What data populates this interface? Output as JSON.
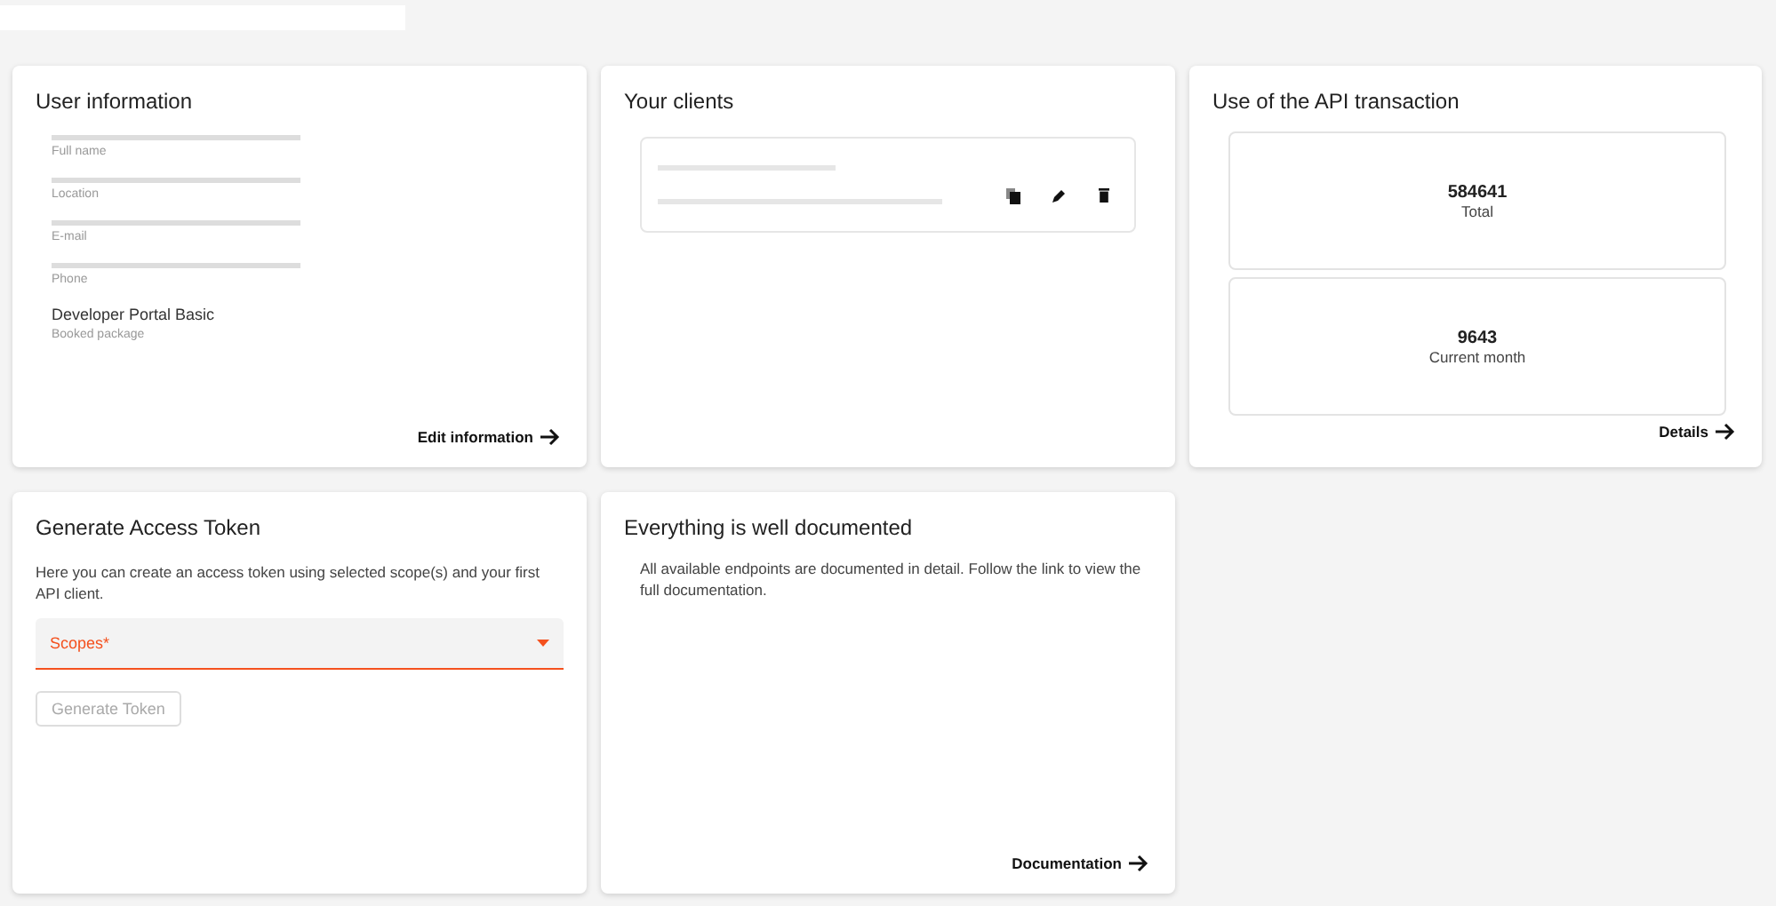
{
  "user_information": {
    "title": "User information",
    "fields": [
      {
        "label": "Full name",
        "redacted": true
      },
      {
        "label": "Location",
        "redacted": true
      },
      {
        "label": "E-mail",
        "redacted": true
      },
      {
        "label": "Phone",
        "redacted": true
      },
      {
        "label": "Booked package",
        "value": "Developer Portal Basic",
        "redacted": false
      }
    ],
    "link": "Edit information"
  },
  "clients": {
    "title": "Your clients",
    "items": [
      {
        "redacted": true
      }
    ]
  },
  "api_usage": {
    "title": "Use of the API transaction",
    "stats": [
      {
        "value": "584641",
        "label": "Total"
      },
      {
        "value": "9643",
        "label": "Current month"
      }
    ],
    "link": "Details"
  },
  "token": {
    "title": "Generate Access Token",
    "description": "Here you can create an access token using selected scope(s) and your first API client.",
    "scopes": {
      "placeholder": "Scopes*",
      "error": true
    },
    "button": {
      "label": "Generate Token",
      "disabled": true
    }
  },
  "docs": {
    "title": "Everything is well documented",
    "description": "All available endpoints are documented in detail. Follow the link to view the full documentation.",
    "link": "Documentation"
  }
}
